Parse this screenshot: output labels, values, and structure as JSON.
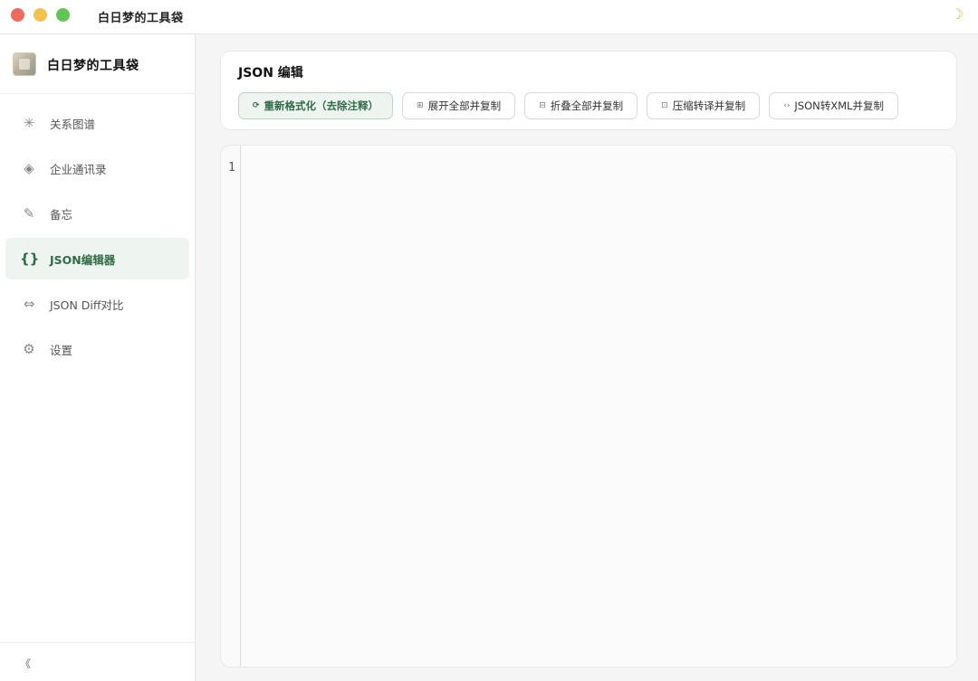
{
  "window": {
    "title": "白日梦的工具袋",
    "theme_icon": "☽"
  },
  "sidebar": {
    "brand_name": "白日梦的工具袋",
    "items": [
      {
        "label": "关系图谱",
        "icon": "✳",
        "icon_name": "graph-icon",
        "active": false
      },
      {
        "label": "企业通讯录",
        "icon": "◈",
        "icon_name": "diamond-icon",
        "active": false
      },
      {
        "label": "备忘",
        "icon": "✎",
        "icon_name": "pencil-icon",
        "active": false
      },
      {
        "label": "JSON编辑器",
        "icon": "{}",
        "icon_name": "braces-icon",
        "active": true
      },
      {
        "label": "JSON Diff对比",
        "icon": "⇔",
        "icon_name": "diff-arrows-icon",
        "active": false
      },
      {
        "label": "设置",
        "icon": "⚙",
        "icon_name": "gear-icon",
        "active": false
      }
    ],
    "collapse_icon": "《"
  },
  "editor": {
    "title": "JSON 编辑",
    "buttons": [
      {
        "label": "重新格式化（去除注释）",
        "icon": "⟳"
      },
      {
        "label": "展开全部并复制",
        "icon": "⊞"
      },
      {
        "label": "折叠全部并复制",
        "icon": "⊟"
      },
      {
        "label": "压缩转译并复制",
        "icon": "⊡"
      },
      {
        "label": "JSON转XML并复制",
        "icon": "‹›"
      }
    ],
    "line_numbers": [
      "1"
    ]
  },
  "colors": {
    "accent": "#2f6b45",
    "active_bg": "#eef4f0"
  }
}
